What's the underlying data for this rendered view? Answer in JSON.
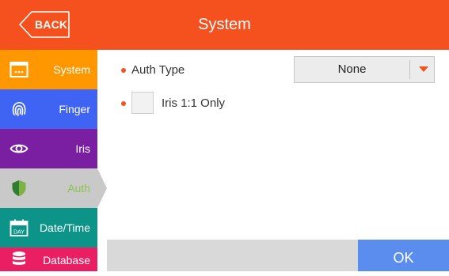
{
  "header": {
    "back_label": "BACK",
    "title": "System"
  },
  "sidebar": {
    "items": [
      {
        "label": "System",
        "icon": "system-window-icon",
        "color": "#ff9800"
      },
      {
        "label": "Finger",
        "icon": "fingerprint-icon",
        "color": "#3f63f2"
      },
      {
        "label": "Iris",
        "icon": "eye-icon",
        "color": "#7b1fa2"
      },
      {
        "label": "Auth",
        "icon": "shield-icon",
        "color": "#c9c9c9",
        "active": true
      },
      {
        "label": "Date/Time",
        "icon": "calendar-day-icon",
        "color": "#0d9488"
      },
      {
        "label": "Database",
        "icon": "database-icon",
        "color": "#e91e63"
      }
    ]
  },
  "content": {
    "auth_type": {
      "label": "Auth Type",
      "selected": "None"
    },
    "iris_only": {
      "label": "Iris 1:1 Only",
      "checked": false
    }
  },
  "footer": {
    "ok_label": "OK"
  },
  "colors": {
    "accent": "#f4511e",
    "ok_button": "#5b8def",
    "footer_bar": "#d9d9d9"
  }
}
